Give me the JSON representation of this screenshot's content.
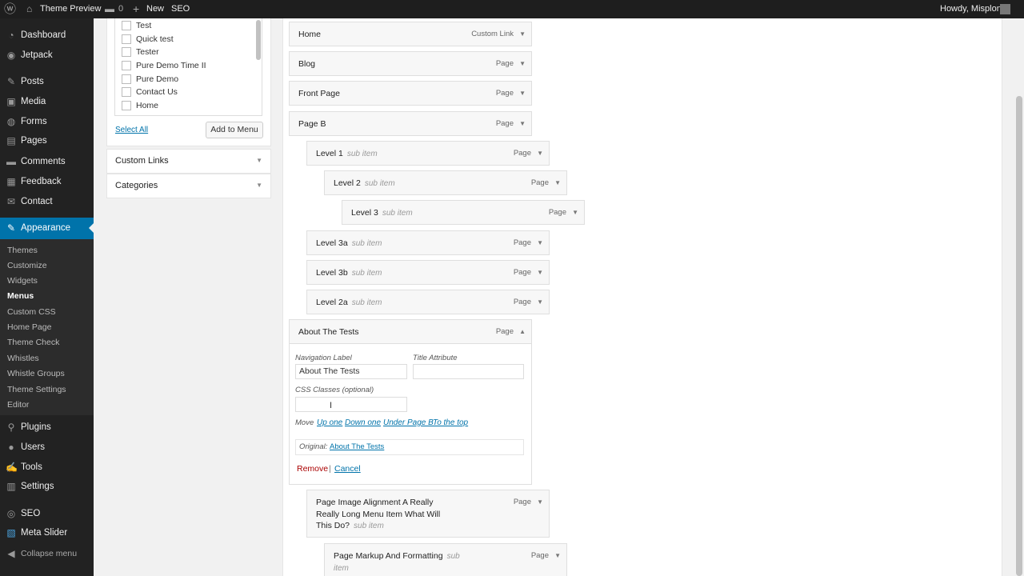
{
  "admin_bar": {
    "site_name": "Theme Preview",
    "comments_count": "0",
    "new_label": "New",
    "seo_label": "SEO",
    "howdy": "Howdy, Misplon"
  },
  "sidebar": {
    "items": [
      {
        "label": "Dashboard",
        "icon": "dashboard-icon",
        "glyph": "◔"
      },
      {
        "label": "Jetpack",
        "icon": "jetpack-icon",
        "glyph": "◉"
      },
      {
        "label": "Posts",
        "icon": "posts-icon",
        "glyph": "✎"
      },
      {
        "label": "Media",
        "icon": "media-icon",
        "glyph": "▣"
      },
      {
        "label": "Forms",
        "icon": "forms-icon",
        "glyph": "◍"
      },
      {
        "label": "Pages",
        "icon": "pages-icon",
        "glyph": "▤"
      },
      {
        "label": "Comments",
        "icon": "comments-icon",
        "glyph": "▬"
      },
      {
        "label": "Feedback",
        "icon": "feedback-icon",
        "glyph": "▦"
      },
      {
        "label": "Contact",
        "icon": "contact-icon",
        "glyph": "✉"
      },
      {
        "label": "Appearance",
        "icon": "appearance-icon",
        "glyph": "✎"
      },
      {
        "label": "Plugins",
        "icon": "plugins-icon",
        "glyph": "⚲"
      },
      {
        "label": "Users",
        "icon": "users-icon",
        "glyph": "●"
      },
      {
        "label": "Tools",
        "icon": "tools-icon",
        "glyph": "✍"
      },
      {
        "label": "Settings",
        "icon": "settings-icon",
        "glyph": "▥"
      },
      {
        "label": "SEO",
        "icon": "seo-icon",
        "glyph": "◎"
      },
      {
        "label": "Meta Slider",
        "icon": "meta-slider-icon",
        "glyph": "▧"
      }
    ],
    "submenu": [
      "Themes",
      "Customize",
      "Widgets",
      "Menus",
      "Custom CSS",
      "Home Page",
      "Theme Check",
      "Whistles",
      "Whistle Groups",
      "Theme Settings",
      "Editor"
    ],
    "collapse": "Collapse menu"
  },
  "pages_box": {
    "checkboxes": [
      "Test",
      "Quick test",
      "Tester",
      "Pure Demo Time II",
      "Pure Demo",
      "Contact Us",
      "Home"
    ],
    "select_all": "Select All",
    "add_button": "Add to Menu"
  },
  "accordions": [
    "Custom Links",
    "Categories"
  ],
  "menu_items": [
    {
      "title": "Home",
      "sub": "",
      "type": "Custom Link"
    },
    {
      "title": "Blog",
      "sub": "",
      "type": "Page"
    },
    {
      "title": "Front Page",
      "sub": "",
      "type": "Page"
    },
    {
      "title": "Page B",
      "sub": "",
      "type": "Page"
    },
    {
      "title": "Level 1",
      "sub": "sub item",
      "type": "Page"
    },
    {
      "title": "Level 2",
      "sub": "sub item",
      "type": "Page"
    },
    {
      "title": "Level 3",
      "sub": "sub item",
      "type": "Page"
    },
    {
      "title": "Level 3a",
      "sub": "sub item",
      "type": "Page"
    },
    {
      "title": "Level 3b",
      "sub": "sub item",
      "type": "Page"
    },
    {
      "title": "Level 2a",
      "sub": "sub item",
      "type": "Page"
    },
    {
      "title": "About The Tests",
      "sub": "",
      "type": "Page"
    }
  ],
  "edit": {
    "nav_label": "Navigation Label",
    "nav_value": "About The Tests",
    "title_attr": "Title Attribute",
    "title_value": "",
    "css_label": "CSS Classes (optional)",
    "css_value": "",
    "move_label": "Move",
    "move_links": [
      "Up one",
      "Down one",
      "Under Page B",
      "To the top"
    ],
    "original_label": "Original:",
    "original_link": "About The Tests",
    "remove": "Remove",
    "sep": "|",
    "cancel": "Cancel"
  },
  "later_items": [
    {
      "title_lines": [
        "Page Image Alignment A Really",
        "Really Long Menu Item What Will",
        "This Do?"
      ],
      "sub": "sub item",
      "type": "Page"
    },
    {
      "title_lines": [
        "Page Markup And Formatting"
      ],
      "sub": "sub",
      "sub2": "item",
      "type": "Page"
    }
  ],
  "colors": {
    "admin_bar": "#1e1e1e",
    "sidebar": "#222222",
    "active": "#0073aa",
    "link": "#0073aa",
    "remove": "#a00000"
  }
}
